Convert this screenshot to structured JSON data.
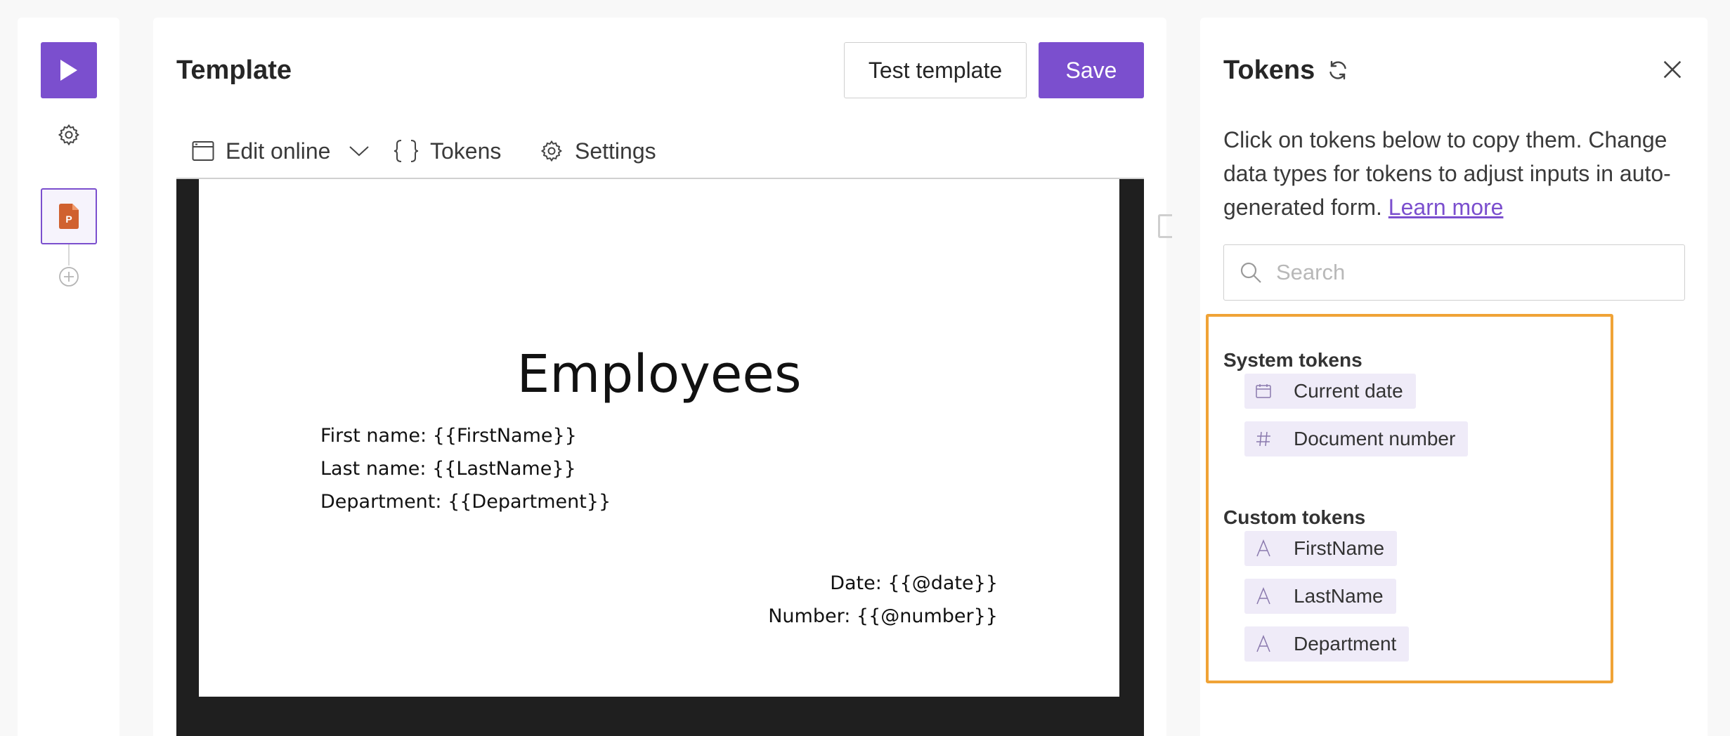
{
  "rail": {
    "play_icon": "play-icon",
    "settings_icon": "gear-icon",
    "document_icon": "powerpoint-file-icon",
    "add_icon": "plus-circle-icon"
  },
  "main": {
    "title": "Template",
    "test_button": "Test template",
    "save_button": "Save",
    "toolbar": {
      "edit_online": "Edit online",
      "tokens": "Tokens",
      "settings": "Settings"
    },
    "slide": {
      "title": "Employees",
      "lines": [
        "First name: {{FirstName}}",
        "Last name: {{LastName}}",
        "Department: {{Department}}"
      ],
      "date_line": "Date: {{@date}}",
      "number_line": "Number: {{@number}}"
    }
  },
  "tokens_panel": {
    "title": "Tokens",
    "description": "Click on tokens below to copy them. Change data types for tokens to adjust inputs in auto-generated form.",
    "learn_more": "Learn more",
    "search_placeholder": "Search",
    "system_label": "System tokens",
    "system_tokens": [
      {
        "label": "Current date",
        "icon": "calendar-icon"
      },
      {
        "label": "Document number",
        "icon": "hash-icon"
      }
    ],
    "custom_label": "Custom tokens",
    "custom_tokens": [
      {
        "label": "FirstName",
        "icon": "text-icon"
      },
      {
        "label": "LastName",
        "icon": "text-icon"
      },
      {
        "label": "Department",
        "icon": "text-icon"
      }
    ]
  },
  "colors": {
    "accent": "#7b4fce",
    "highlight": "#f0a336",
    "chip_bg": "#efebf8"
  }
}
